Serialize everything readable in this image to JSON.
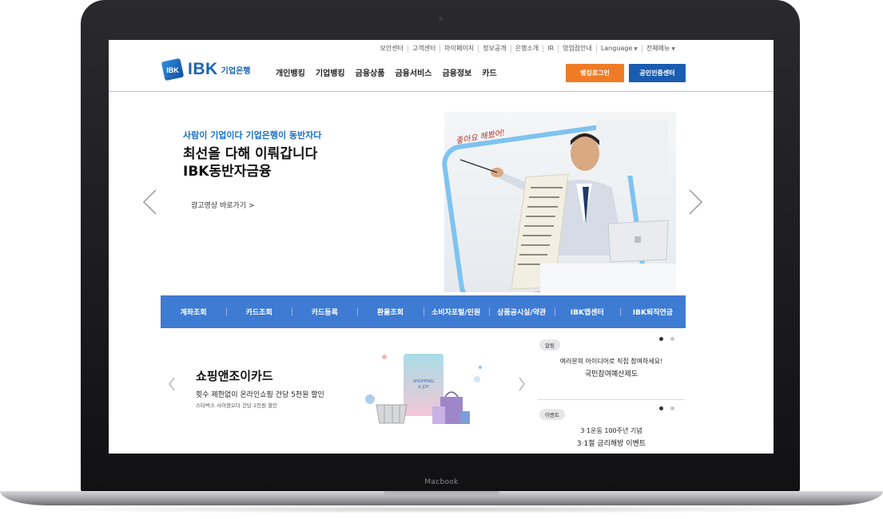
{
  "device": {
    "label": "Macbook"
  },
  "utility_nav": [
    "보안센터",
    "고객센터",
    "마이페이지",
    "정보공개",
    "은행소개",
    "IR",
    "영업점안내",
    "Language",
    "전체메뉴"
  ],
  "logo": {
    "brand": "IBK",
    "sub": "기업은행",
    "mark_text": "IBK"
  },
  "gnb": [
    "개인뱅킹",
    "기업뱅킹",
    "금융상품",
    "금융서비스",
    "금융정보",
    "카드"
  ],
  "header_buttons": {
    "login": "뱅킹로그인",
    "cert": "공인인증센터"
  },
  "hero": {
    "eyebrow": "사람이 기업이다 기업은행이 동반자다",
    "title_line1": "최선을 다해 이뤄갑니다",
    "title_line2": "IBK동반자금융",
    "link": "광고영상 바로가기 >"
  },
  "quick_menu": [
    "계좌조회",
    "카드조회",
    "카드등록",
    "환율조회",
    "소비자포털/민원",
    "상품공시실/약관",
    "IBK앱센터",
    "IBK퇴직연금"
  ],
  "promo": {
    "title": "쇼핑앤조이카드",
    "desc": "횟수 제한없이 온라인쇼핑 건당 5천원 할인",
    "sub": "스타벅스 사이렌오더 건당 2천원 할인",
    "card_text": "SHOPPING & JOY"
  },
  "notices": [
    {
      "badge": "알림",
      "line1": "여러분의 아이디어로 직접 참여하세요!",
      "line2": "국민참여예산제도"
    },
    {
      "badge": "이벤트",
      "line1": "3·1운동 100주년 기념",
      "line2": "3·1절 금리해방 이벤트"
    }
  ],
  "colors": {
    "brand_blue": "#1a62b4",
    "quick_bar": "#3e7bd2",
    "login_orange": "#f07b25",
    "cert_blue": "#1a5cb1"
  }
}
